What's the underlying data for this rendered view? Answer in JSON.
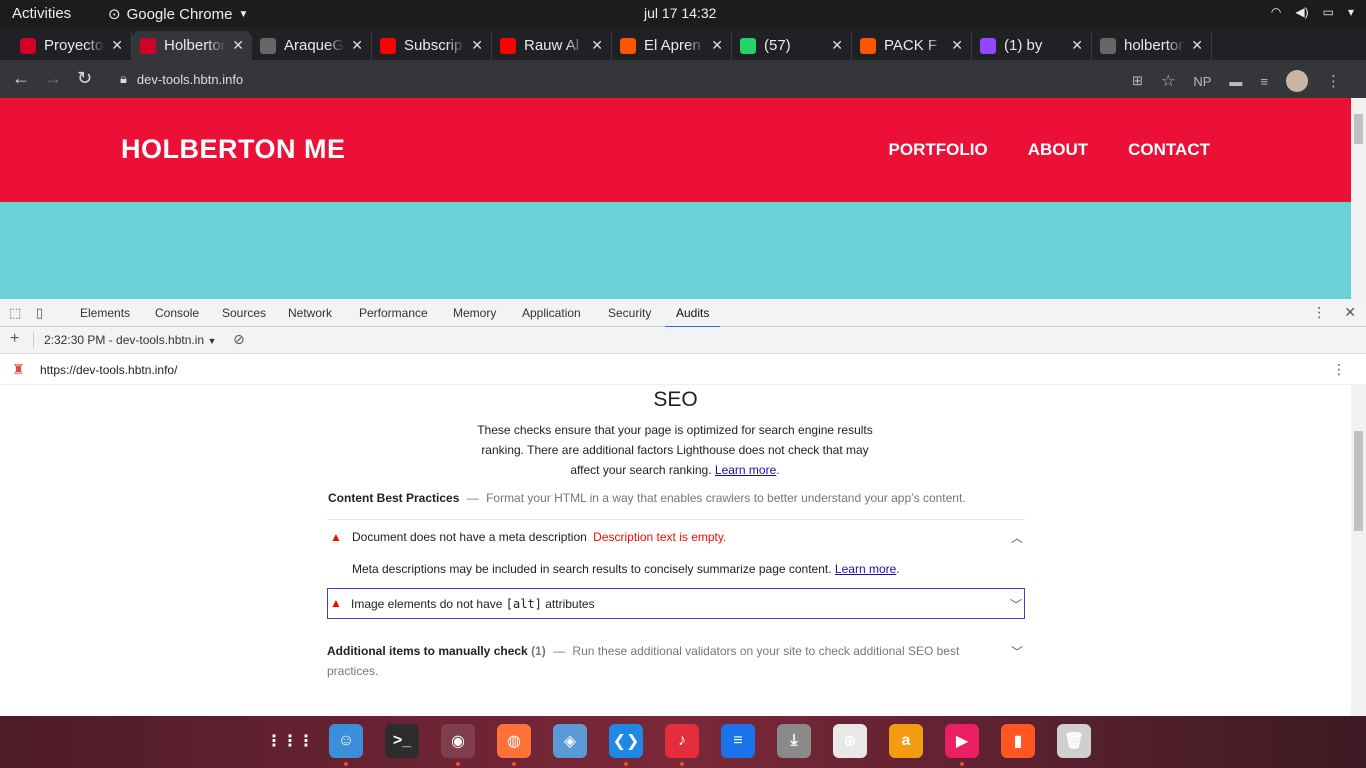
{
  "topbar": {
    "activities": "Activities",
    "app_name": "Google Chrome",
    "clock": "jul 17  14:32"
  },
  "tabs": [
    {
      "title": "Proyecto",
      "fav": "holberton-icon",
      "color": "#d3002a"
    },
    {
      "title": "Holberton",
      "fav": "holberton-icon",
      "color": "#d3002a"
    },
    {
      "title": "AraqueG",
      "fav": "github-icon",
      "color": "#666"
    },
    {
      "title": "Subscrip",
      "fav": "youtube-icon",
      "color": "#ff0000"
    },
    {
      "title": "Rauw Al",
      "fav": "youtube-icon",
      "color": "#ff0000"
    },
    {
      "title": "El Apren",
      "fav": "soundcloud-icon",
      "color": "#ff5500"
    },
    {
      "title": "(57)",
      "fav": "whatsapp-icon",
      "color": "#25d366"
    },
    {
      "title": "PACK F",
      "fav": "soundcloud-icon",
      "color": "#ff5500"
    },
    {
      "title": "(1) by",
      "fav": "twitch-icon",
      "color": "#9146ff"
    },
    {
      "title": "holberton",
      "fav": "github-icon",
      "color": "#666"
    }
  ],
  "toolbar": {
    "url": "dev-tools.hbtn.info",
    "ext_np": "NP"
  },
  "site": {
    "logo": "HOLBERTON ME",
    "menu": [
      "PORTFOLIO",
      "ABOUT",
      "CONTACT"
    ],
    "header_color": "#ec0f36",
    "hero_color": "#6ad1d6"
  },
  "devtools": {
    "tabs": [
      "Elements",
      "Console",
      "Sources",
      "Network",
      "Performance",
      "Memory",
      "Application",
      "Security",
      "Audits"
    ],
    "selected_tab": "Audits",
    "report_select": "2:32:30 PM - dev-tools.hbtn.in",
    "report_url": "https://dev-tools.hbtn.info/"
  },
  "report": {
    "title": "SEO",
    "desc1": "These checks ensure that your page is optimized for search engine results ranking. There are additional factors Lighthouse does not check that may affect your search ranking.",
    "learn_more": "Learn more",
    "group_title": "Content Best Practices",
    "group_sep": "—",
    "group_desc": "Format your HTML in a way that enables crawlers to better understand your app’s content.",
    "audit1_title": "Document does not have a meta description",
    "audit1_err": "Description text is empty.",
    "audit1_detail": "Meta descriptions may be included in search results to concisely summarize page content.",
    "audit2_pre": "Image elements do not have ",
    "audit2_code": "[alt]",
    "audit2_post": " attributes",
    "manual_title": "Additional items to manually check",
    "manual_count": "(1)",
    "manual_desc": "Run these additional validators on your site to check additional SEO best practices."
  },
  "dock": [
    {
      "name": "apps-grid-icon",
      "color": "transparent",
      "glyph": "⋮⋮⋮"
    },
    {
      "name": "files-icon",
      "color": "#3a8fd8",
      "glyph": "☺"
    },
    {
      "name": "terminal-icon",
      "color": "#2c2c2c",
      "glyph": ">_"
    },
    {
      "name": "chrome-icon",
      "color": "#4285f4",
      "glyph": "◉"
    },
    {
      "name": "firefox-icon",
      "color": "#ff7139",
      "glyph": "◍"
    },
    {
      "name": "remote-icon",
      "color": "#5b9bd5",
      "glyph": "◈"
    },
    {
      "name": "vscode-icon",
      "color": "#1e88e5",
      "glyph": "❮❯"
    },
    {
      "name": "music-icon",
      "color": "#e52d3c",
      "glyph": "♪"
    },
    {
      "name": "writer-icon",
      "color": "#1a73e8",
      "glyph": "≡"
    },
    {
      "name": "install-icon",
      "color": "#8a8a8a",
      "glyph": "⤓"
    },
    {
      "name": "help-icon",
      "color": "#e8e8e8",
      "glyph": "⊕"
    },
    {
      "name": "amazon-icon",
      "color": "#f39c12",
      "glyph": "a"
    },
    {
      "name": "video-icon",
      "color": "#e91e63",
      "glyph": "▶"
    },
    {
      "name": "phone-icon",
      "color": "#ff5722",
      "glyph": "▮"
    },
    {
      "name": "trash-icon",
      "color": "#cfcfcf",
      "glyph": "🗑"
    }
  ]
}
